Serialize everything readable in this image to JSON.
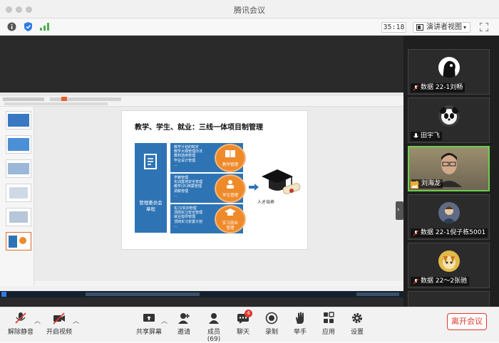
{
  "window": {
    "title": "腾讯会议"
  },
  "info_bar": {
    "timer": "35:18",
    "view_mode": "演讲者视图"
  },
  "slide": {
    "title": "教学、学生、就业：三线一体项目制管理",
    "left_box_label": "管理委员会\n章程",
    "bands": [
      {
        "lines": [
          "教学计划的制定",
          "教学大纲管理办法",
          "教材选用管理",
          "毕业设计管理",
          "..."
        ],
        "label": "教学管理"
      },
      {
        "lines": [
          "学籍管理",
          "实训基地安全管理",
          "教学(外)档案管理",
          "调薪管理",
          "..."
        ],
        "label": "学生管理"
      },
      {
        "lines": [
          "实习/实训管理",
          "顶岗实习安全管理",
          "就业指导管理",
          "顶岗实习安置计划",
          "..."
        ],
        "label": "实习就业\n管理"
      }
    ],
    "graduate_label": "人才培养"
  },
  "participants": [
    {
      "name": "数据 22-1刘畅",
      "muted": true
    },
    {
      "name": "田宇飞",
      "muted": false
    },
    {
      "name": "刘海龙",
      "muted": false,
      "active": true
    },
    {
      "name": "数据 22-1倪子栋5001",
      "muted": true
    },
    {
      "name": "数据 22～2张驰",
      "muted": true
    }
  ],
  "toolbar": {
    "unmute": "解除静音",
    "start_video": "开启视频",
    "share_screen": "共享屏幕",
    "invite": "邀请",
    "members": "成员(69)",
    "chat": "聊天",
    "chat_badge": "4",
    "record": "录制",
    "raise_hand": "举手",
    "apps": "应用",
    "settings": "设置",
    "leave": "离开会议"
  },
  "colors": {
    "accent_red": "#e0392f",
    "active_speaker": "#6bd04c",
    "slide_blue": "#2e74b5",
    "slide_orange": "#ef8a2b"
  }
}
